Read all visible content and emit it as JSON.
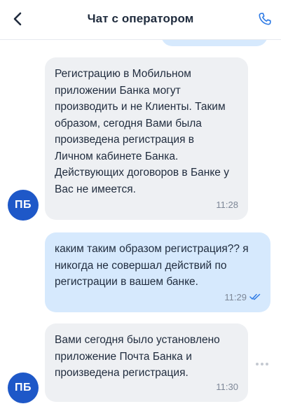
{
  "header": {
    "title": "Чат с оператором",
    "back_icon": "chevron-left-icon",
    "call_icon": "phone-icon"
  },
  "operator": {
    "avatar_initials": "ПБ",
    "avatar_color": "#1e58c8"
  },
  "messages": [
    {
      "direction": "incoming",
      "text": "Регистрацию в Мобильном\nприложении Банка могут\nпроизводить и не Клиенты. Таким\nобразом, сегодня Вами была\nпроизведена регистрация в\nЛичном кабинете Банка.\nДействующих договоров в Банке у\nВас не имеется.",
      "time": "11:28"
    },
    {
      "direction": "outgoing",
      "text": "каким таким образом регистрация?? я\nникогда не совершал действий по\nрегистрации в вашем банке.",
      "time": "11:29",
      "status": "read"
    },
    {
      "direction": "incoming",
      "text": "Вами сегодня было установлено\nприложение Почта Банка и\nпроизведена регистрация.",
      "time": "11:30"
    }
  ],
  "colors": {
    "incoming_bubble": "#eef0f3",
    "outgoing_bubble": "#d6e9fd",
    "accent": "#2f7be5"
  }
}
